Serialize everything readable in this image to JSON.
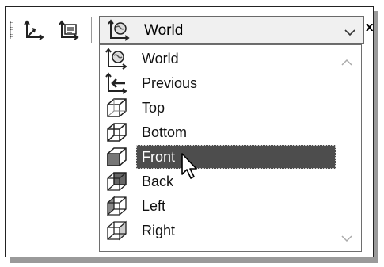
{
  "toolbar": {
    "close_label": "x",
    "combo": {
      "selected": "World"
    }
  },
  "views": {
    "items": [
      {
        "label": "World",
        "icon": "world-ucs-icon"
      },
      {
        "label": "Previous",
        "icon": "previous-ucs-icon"
      },
      {
        "label": "Top",
        "icon": "top-view-icon"
      },
      {
        "label": "Bottom",
        "icon": "bottom-view-icon"
      },
      {
        "label": "Front",
        "icon": "front-view-icon"
      },
      {
        "label": "Back",
        "icon": "back-view-icon"
      },
      {
        "label": "Left",
        "icon": "left-view-icon"
      },
      {
        "label": "Right",
        "icon": "right-view-icon"
      }
    ],
    "highlighted": "Front"
  },
  "colors": {
    "highlight": "#4d4d4d",
    "frame": "#222222",
    "shadow": "#9a9a9a"
  }
}
